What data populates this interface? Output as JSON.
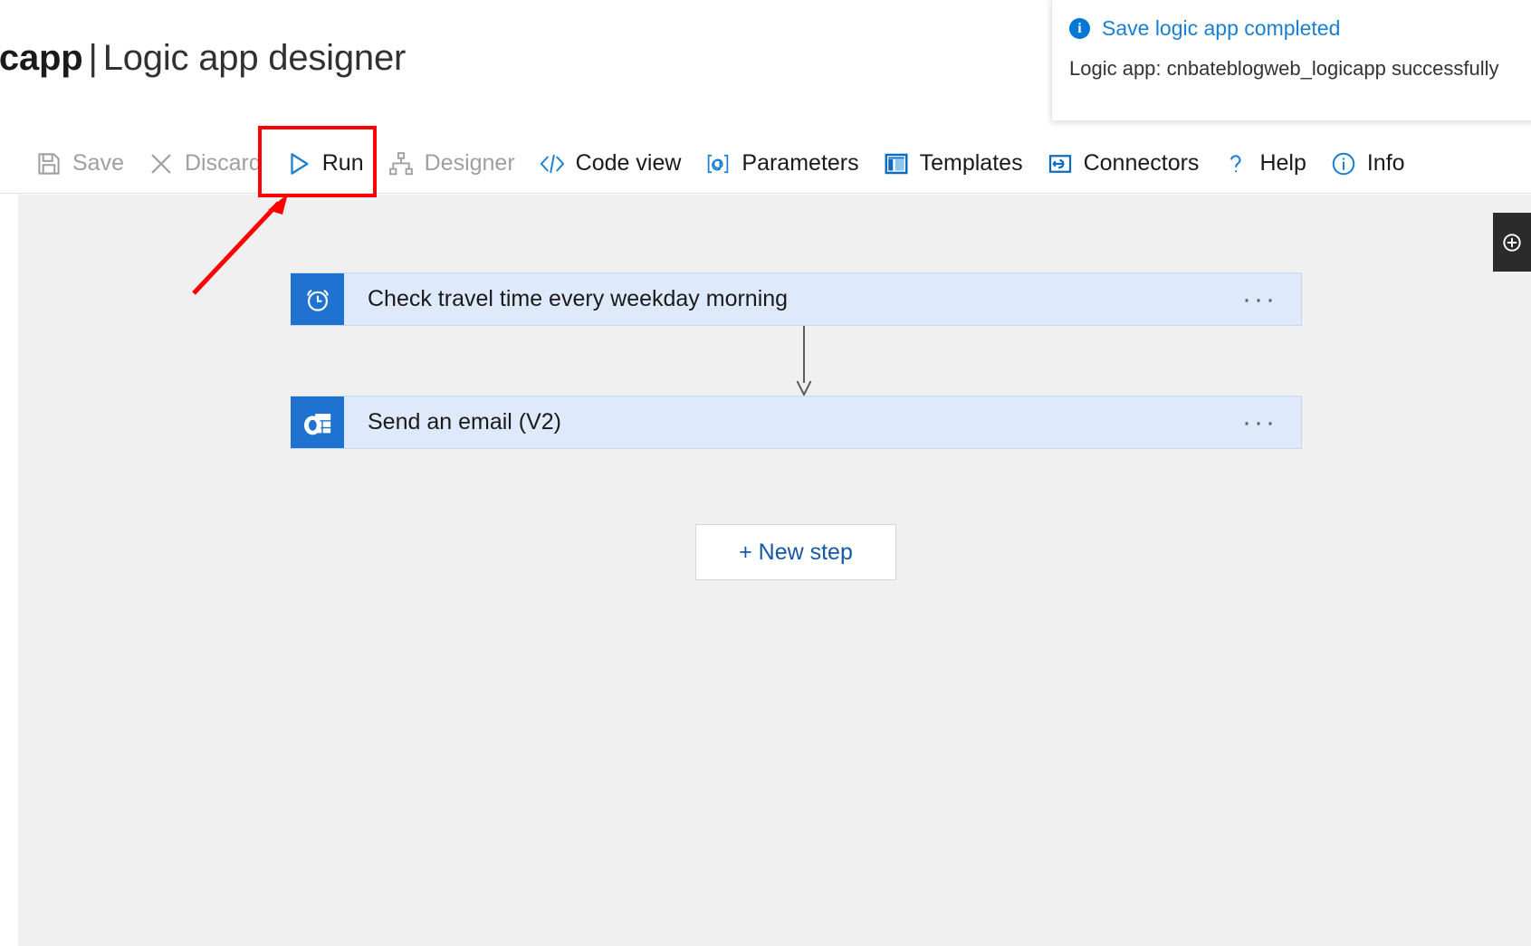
{
  "header": {
    "resource_name": "icapp",
    "separator": "|",
    "subtitle": "Logic app designer"
  },
  "notification": {
    "icon": "info-icon",
    "title": "Save logic app completed",
    "body": "Logic app: cnbateblogweb_logicapp successfully"
  },
  "toolbar": {
    "items": [
      {
        "label": "Save",
        "icon": "save-icon",
        "enabled": false
      },
      {
        "label": "Discard",
        "icon": "close-icon",
        "enabled": false
      },
      {
        "label": "Run",
        "icon": "play-icon",
        "enabled": true
      },
      {
        "label": "Designer",
        "icon": "sitemap-icon",
        "enabled": false
      },
      {
        "label": "Code view",
        "icon": "code-icon",
        "enabled": true
      },
      {
        "label": "Parameters",
        "icon": "parameters-icon",
        "enabled": true
      },
      {
        "label": "Templates",
        "icon": "templates-icon",
        "enabled": true
      },
      {
        "label": "Connectors",
        "icon": "connectors-icon",
        "enabled": true
      },
      {
        "label": "Help",
        "icon": "question-icon",
        "enabled": true
      },
      {
        "label": "Info",
        "icon": "info-circle-icon",
        "enabled": true
      }
    ]
  },
  "designer": {
    "cards": [
      {
        "title": "Check travel time every weekday morning",
        "icon": "alarm-clock-icon",
        "menu": "···"
      },
      {
        "title": "Send an email (V2)",
        "icon": "outlook-icon",
        "menu": "···"
      }
    ],
    "new_step_label": "+ New step",
    "zoom_control_icon": "zoom-in-icon"
  },
  "annotations": {
    "highlight_target": "Run",
    "color": "#ff0000"
  },
  "colors": {
    "accent_blue": "#0078d4",
    "card_fill": "#deeafc",
    "card_icon": "#1f72d0",
    "canvas": "#f0f0f0",
    "link": "#1558a8"
  }
}
